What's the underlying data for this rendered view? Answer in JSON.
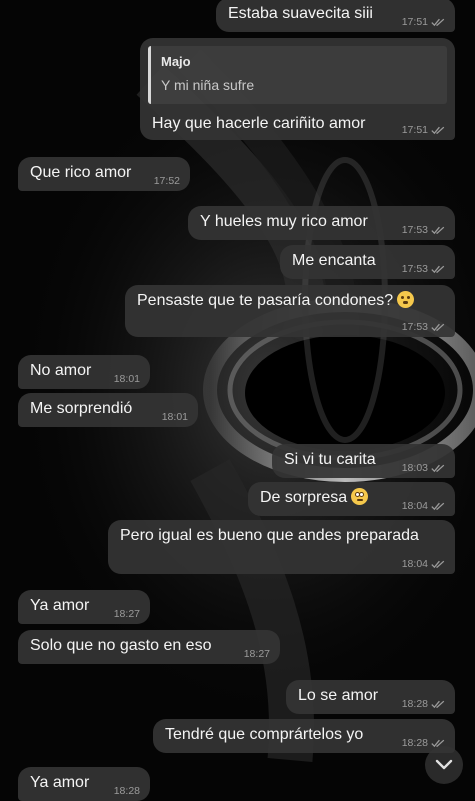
{
  "reply_preview": {
    "name": "Majo",
    "text": "Y mi niña sufre"
  },
  "messages": [
    {
      "dir": "out",
      "text": "Estaba suavecita siii",
      "time": "17:51"
    },
    {
      "dir": "out",
      "text": "Hay que hacerle cariñito amor",
      "time": "17:51",
      "reply": true
    },
    {
      "dir": "in",
      "text": "Que rico amor",
      "time": "17:52"
    },
    {
      "dir": "out",
      "text": "Y hueles muy rico amor",
      "time": "17:53"
    },
    {
      "dir": "out",
      "text": "Me encanta",
      "time": "17:53"
    },
    {
      "dir": "out",
      "text": "Pensaste que te pasaría condones?",
      "time": "17:53",
      "emoji": "shushing-face-emoji"
    },
    {
      "dir": "in",
      "text": "No amor",
      "time": "18:01"
    },
    {
      "dir": "in",
      "text": "Me sorprendió",
      "time": "18:01"
    },
    {
      "dir": "out",
      "text": "Si vi tu carita",
      "time": "18:03"
    },
    {
      "dir": "out",
      "text": "De sorpresa",
      "time": "18:04",
      "emoji": "rolling-eyes-face-emoji"
    },
    {
      "dir": "out",
      "text": "Pero igual es bueno que andes preparada",
      "time": "18:04"
    },
    {
      "dir": "in",
      "text": "Ya amor",
      "time": "18:27"
    },
    {
      "dir": "in",
      "text": "Solo que no gasto en eso",
      "time": "18:27"
    },
    {
      "dir": "out",
      "text": "Lo se amor",
      "time": "18:28"
    },
    {
      "dir": "out",
      "text": "Tendré que comprártelos yo",
      "time": "18:28"
    },
    {
      "dir": "in",
      "text": "Ya amor",
      "time": "18:28"
    }
  ],
  "icons": {
    "read_receipt": "double-check-icon",
    "scroll_down": "chevron-down-icon"
  },
  "colors": {
    "background": "#050505",
    "bubble": "#343434",
    "text": "#f2f2f2",
    "time": "#9b9b9b"
  }
}
